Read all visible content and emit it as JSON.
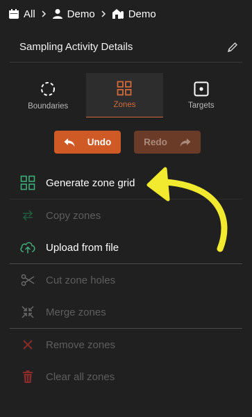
{
  "breadcrumb": {
    "items": [
      {
        "label": "All",
        "icon": "calendar-icon"
      },
      {
        "label": "Demo",
        "icon": "person-icon"
      },
      {
        "label": "Demo",
        "icon": "farm-icon"
      }
    ]
  },
  "header": {
    "title": "Sampling Activity Details",
    "edit_icon": "pencil-icon"
  },
  "tabs": [
    {
      "label": "Boundaries",
      "icon": "boundary-icon",
      "active": false
    },
    {
      "label": "Zones",
      "icon": "zones-grid-icon",
      "active": true
    },
    {
      "label": "Targets",
      "icon": "target-icon",
      "active": false
    }
  ],
  "actions": {
    "undo_label": "Undo",
    "redo_label": "Redo"
  },
  "menu": {
    "generate_grid": "Generate zone grid",
    "copy_zones": "Copy zones",
    "upload_file": "Upload from file",
    "cut_holes": "Cut zone holes",
    "merge_zones": "Merge zones",
    "remove_zones": "Remove zones",
    "clear_all": "Clear all zones"
  },
  "colors": {
    "background": "#202020",
    "accent": "#d36a3c",
    "undo": "#cf5a26",
    "redo": "#6a3b27",
    "green": "#3fae77",
    "red": "#8a2b2b",
    "annotation_arrow": "#f2ea2e"
  }
}
